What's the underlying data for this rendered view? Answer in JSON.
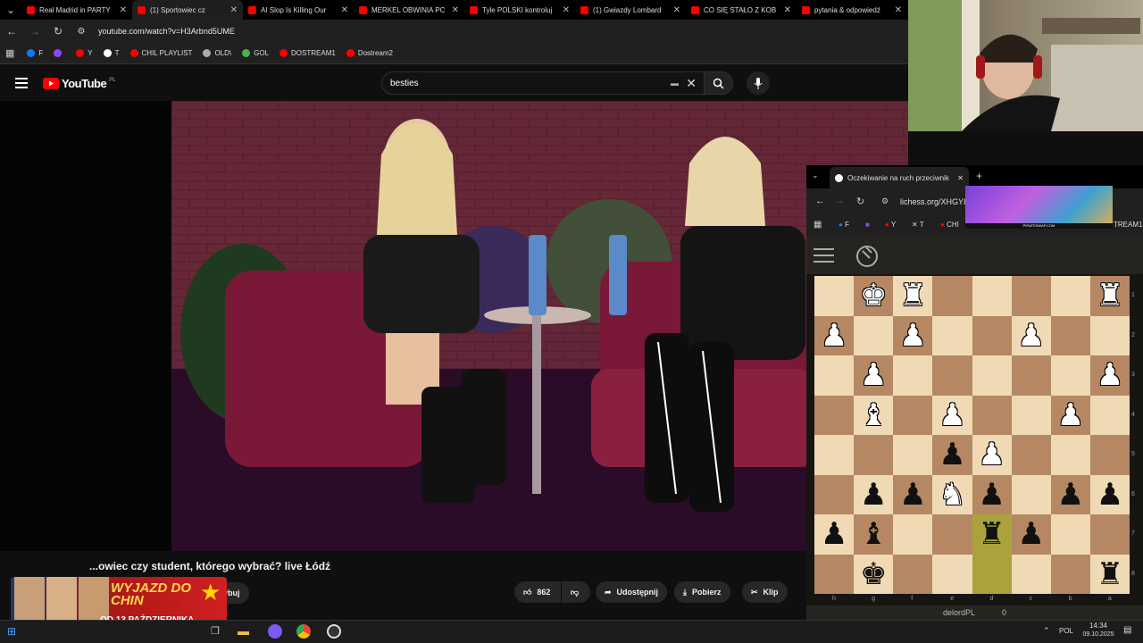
{
  "browser": {
    "tabs": [
      {
        "title": "Real Madrid in PARTY"
      },
      {
        "title": "(1) Sportowiec cz"
      },
      {
        "title": "AI Slop Is Killing Our"
      },
      {
        "title": "MERKEL OBWINIA PC"
      },
      {
        "title": "Tyle POLSKI kontroluj"
      },
      {
        "title": "(1) Gwiazdy Lombard"
      },
      {
        "title": "CO SIĘ STAŁO Z KOB"
      },
      {
        "title": "pytania & odpowiedź"
      }
    ],
    "url": "youtube.com/watch?v=H3Arbnd5UME",
    "bookmarks": [
      {
        "label": "F",
        "color": "#1877f2"
      },
      {
        "label": "",
        "color": "#9146ff"
      },
      {
        "label": "Y",
        "color": "#ff0000"
      },
      {
        "label": "T",
        "color": "#ffffff"
      },
      {
        "label": "CHIL PLAYLIST",
        "color": "#ff0000"
      },
      {
        "label": "OLD\\",
        "color": "#aaaaaa"
      },
      {
        "label": "GOL",
        "color": "#4caf50"
      },
      {
        "label": "DOSTREAM1",
        "color": "#ff0000"
      },
      {
        "label": "Dostream2",
        "color": "#ff0000"
      }
    ]
  },
  "youtube": {
    "logo": "YouTube",
    "region": "PL",
    "search_value": "besties",
    "video_title": "...owiec czy student, którego wybrać? live Łódź",
    "subscribe": "ybuj",
    "likes": "862",
    "share": "Udostępnij",
    "download": "Pobierz",
    "clip": "Klip"
  },
  "promo": {
    "line1": "WYJAZD DO CHIN",
    "line2": "OD 13 PAŹDZIERNIKA"
  },
  "lichess": {
    "tab_title": "Oczekiwanie na ruch przeciwnik",
    "url": "lichess.org/XHGYI",
    "bookmarks_tail": "TREAM1",
    "banner_text": "PIRATESWAP.COM",
    "player": "delordPL",
    "score": "0",
    "files": [
      "h",
      "g",
      "f",
      "e",
      "d",
      "c",
      "b",
      "a"
    ],
    "ranks": [
      "1",
      "2",
      "3",
      "4",
      "5",
      "6",
      "7",
      "8"
    ],
    "board": [
      [
        "",
        "wK",
        "wR",
        "",
        "",
        "",
        "",
        "wR"
      ],
      [
        "wP",
        "",
        "wP",
        "",
        "",
        "wP",
        "",
        ""
      ],
      [
        "",
        "wP",
        "",
        "",
        "",
        "",
        "",
        "wP"
      ],
      [
        "",
        "wB",
        "",
        "wP",
        "",
        "",
        "wP",
        ""
      ],
      [
        "",
        "",
        "",
        "bP",
        "wP",
        "",
        "",
        ""
      ],
      [
        "",
        "bP",
        "bP",
        "wN",
        "bP",
        "",
        "bP",
        "bP"
      ],
      [
        "bP",
        "bB",
        "",
        "",
        "bR",
        "bP",
        "",
        ""
      ],
      [
        "",
        "bK",
        "",
        "",
        "",
        "",
        "",
        "bR"
      ]
    ],
    "highlight": [
      "6-4",
      "7-4"
    ]
  },
  "taskbar": {
    "lang": "POL",
    "time": "14:34",
    "date": "09.10.2025"
  }
}
